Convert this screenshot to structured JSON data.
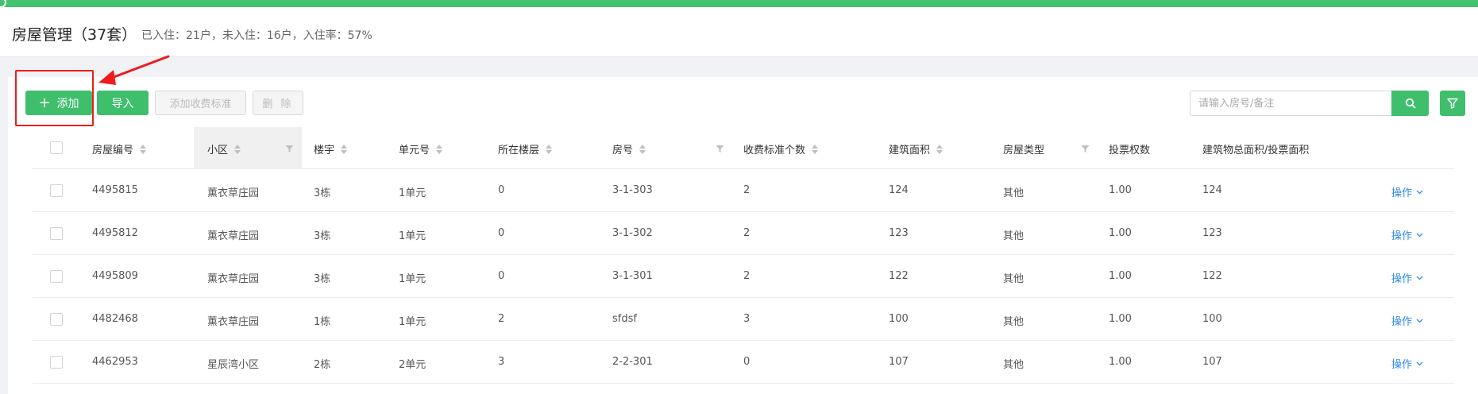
{
  "header": {
    "title": "房屋管理（37套）",
    "stats": "已入住：21户，未入住：16户，入住率：57%"
  },
  "toolbar": {
    "add_label": "添加",
    "import_label": "导入",
    "add_fee_label": "添加收费标准",
    "delete_label": "删 除"
  },
  "search": {
    "placeholder": "请输入房号/备注"
  },
  "table": {
    "columns": [
      "房屋编号",
      "小区",
      "楼宇",
      "单元号",
      "所在楼层",
      "房号",
      "收费标准个数",
      "建筑面积",
      "房屋类型",
      "投票权数",
      "建筑物总面积/投票面积"
    ],
    "action_label": "操作",
    "rows": [
      [
        "4495815",
        "薰衣草庄园",
        "3栋",
        "1单元",
        "0",
        "3-1-303",
        "2",
        "124",
        "其他",
        "1.00",
        "124"
      ],
      [
        "4495812",
        "薰衣草庄园",
        "3栋",
        "1单元",
        "0",
        "3-1-302",
        "2",
        "123",
        "其他",
        "1.00",
        "123"
      ],
      [
        "4495809",
        "薰衣草庄园",
        "3栋",
        "1单元",
        "0",
        "3-1-301",
        "2",
        "122",
        "其他",
        "1.00",
        "122"
      ],
      [
        "4482468",
        "薰衣草庄园",
        "1栋",
        "1单元",
        "2",
        "sfdsf",
        "3",
        "100",
        "其他",
        "1.00",
        "100"
      ],
      [
        "4462953",
        "星辰湾小区",
        "2栋",
        "2单元",
        "3",
        "2-2-301",
        "0",
        "107",
        "其他",
        "1.00",
        "107"
      ]
    ]
  },
  "colors": {
    "brand_green": "#3fbf6c",
    "link_blue": "#2d8cf0",
    "annotation_red": "#ee1c1c"
  }
}
